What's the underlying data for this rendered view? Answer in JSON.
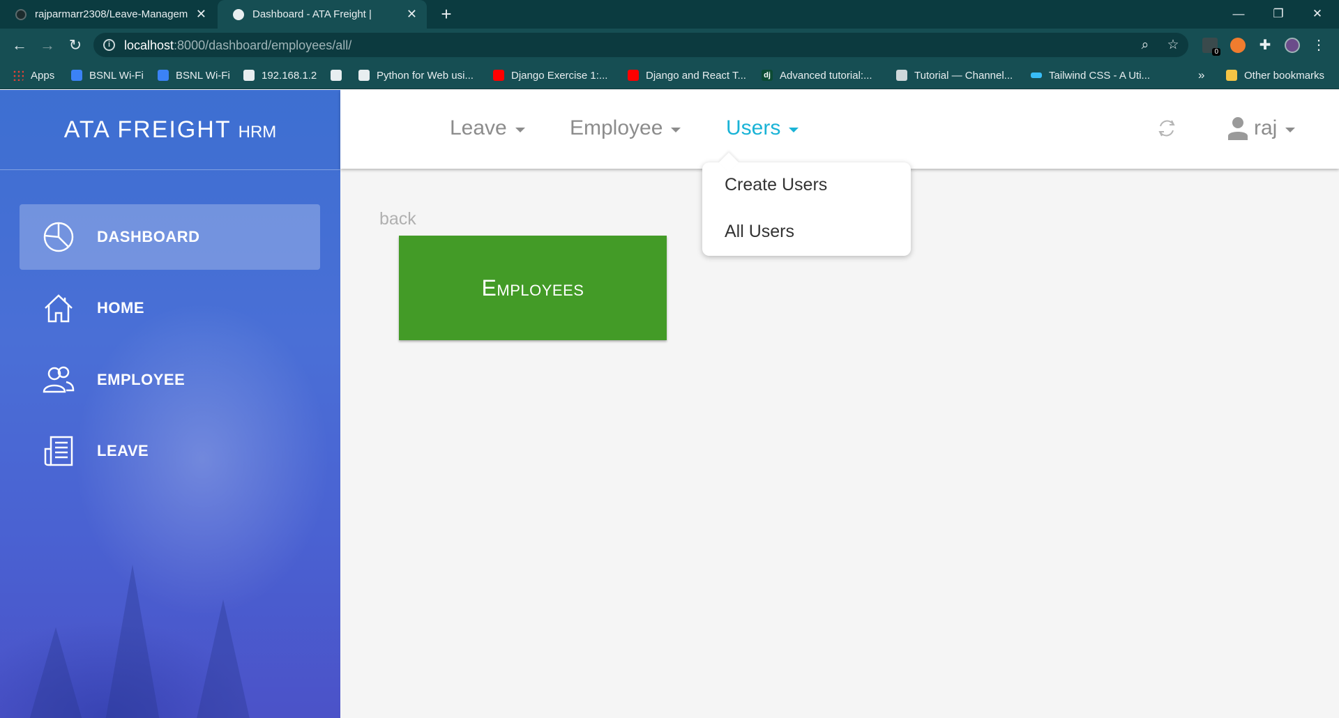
{
  "browser": {
    "tabs": [
      {
        "title": "rajparmarr2308/Leave-Managem",
        "active": false
      },
      {
        "title": "Dashboard - ATA Freight |",
        "active": true
      }
    ],
    "url_host": "localhost",
    "url_path": ":8000/dashboard/employees/all/",
    "bookmarks": [
      {
        "label": "Apps",
        "icon": "apps-icon"
      },
      {
        "label": "BSNL Wi-Fi",
        "icon": "wifi-icon"
      },
      {
        "label": "BSNL Wi-Fi",
        "icon": "wifi-icon"
      },
      {
        "label": "192.168.1.2",
        "icon": "globe-icon"
      },
      {
        "label": "Python for Web usi...",
        "icon": "globe-icon"
      },
      {
        "label": "Django Exercise 1:...",
        "icon": "youtube-icon"
      },
      {
        "label": "Django and React T...",
        "icon": "youtube-icon"
      },
      {
        "label": "Advanced tutorial:...",
        "icon": "django-icon"
      },
      {
        "label": "Tutorial — Channel...",
        "icon": "doc-icon"
      },
      {
        "label": "Tailwind CSS - A Uti...",
        "icon": "tailwind-icon"
      },
      {
        "label": "Other bookmarks",
        "icon": "folder-icon"
      }
    ],
    "overflow_label": "»",
    "extension_badge": "0"
  },
  "sidebar": {
    "brand_main": "ATA FREIGHT",
    "brand_sub": "HRM",
    "items": [
      {
        "label": "DASHBOARD",
        "icon": "pie-chart-icon",
        "active": true
      },
      {
        "label": "HOME",
        "icon": "home-icon",
        "active": false
      },
      {
        "label": "EMPLOYEE",
        "icon": "users-icon",
        "active": false
      },
      {
        "label": "LEAVE",
        "icon": "newspaper-icon",
        "active": false
      }
    ]
  },
  "topnav": {
    "menus": [
      {
        "label": "Leave",
        "active": false
      },
      {
        "label": "Employee",
        "active": false
      },
      {
        "label": "Users",
        "active": true
      }
    ],
    "user_name": "raj",
    "accent_color": "#1ab3d6"
  },
  "dropdown": {
    "items": [
      "Create Users",
      "All Users"
    ]
  },
  "main": {
    "back_label": "back",
    "card_label": "Employees",
    "card_color": "#439b27"
  }
}
